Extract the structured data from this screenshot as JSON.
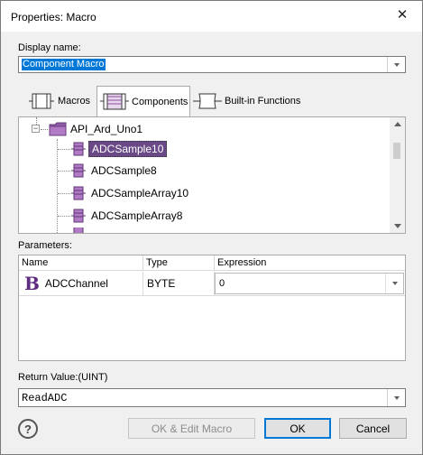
{
  "window": {
    "title": "Properties: Macro",
    "close_glyph": "✕"
  },
  "display_name": {
    "label": "Display name:",
    "value": "Component Macro"
  },
  "tabs": [
    {
      "label": "Macros",
      "icon": "macros-icon"
    },
    {
      "label": "Components",
      "icon": "components-icon",
      "active": true
    },
    {
      "label": "Built-in Functions",
      "icon": "builtin-functions-icon"
    }
  ],
  "tree": {
    "root": {
      "label": "API_Ard_Uno1",
      "expander": "−"
    },
    "items": [
      {
        "label": "ADCSample10",
        "selected": true
      },
      {
        "label": "ADCSample8"
      },
      {
        "label": "ADCSampleArray10"
      },
      {
        "label": "ADCSampleArray8"
      }
    ]
  },
  "parameters": {
    "label": "Parameters:",
    "columns": [
      "Name",
      "Type",
      "Expression"
    ],
    "rows": [
      {
        "type_icon": "B",
        "name": "ADCChannel",
        "type": "BYTE",
        "expression": "0"
      }
    ]
  },
  "return_value": {
    "label": "Return Value:(UINT)",
    "value": "ReadADC"
  },
  "buttons": {
    "help": "?",
    "ok_edit": "OK & Edit Macro",
    "ok": "OK",
    "cancel": "Cancel"
  },
  "colors": {
    "accent": "#0078d7",
    "component_purple": "#8a4fa0",
    "selected_bg": "#6a4a86"
  }
}
